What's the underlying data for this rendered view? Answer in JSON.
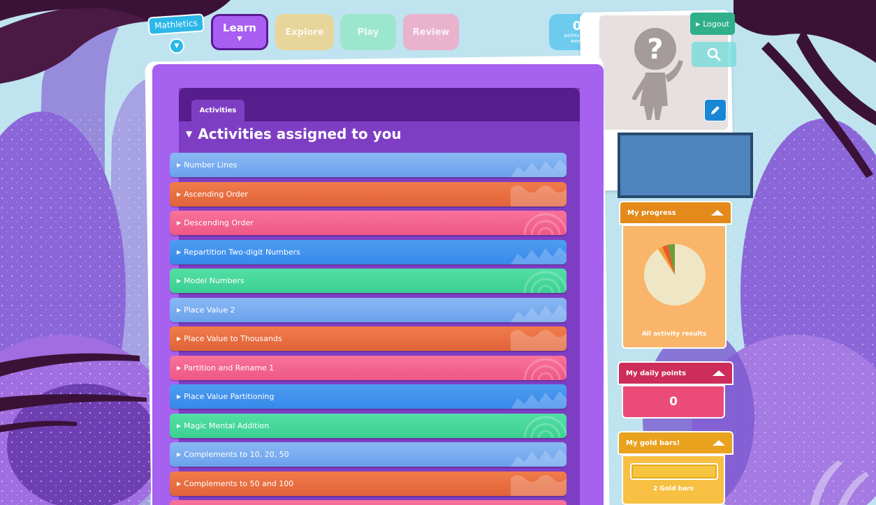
{
  "nav": {
    "brand": "Mathletics",
    "tabs": [
      {
        "label": "Learn"
      },
      {
        "label": "Explore"
      },
      {
        "label": "Play"
      },
      {
        "label": "Review"
      }
    ],
    "points_value": "0",
    "points_label": "points this week"
  },
  "profile": {
    "logout_label": "Logout",
    "avatar_icon": "question-mark-avatar-icon",
    "search_icon": "search-icon",
    "edit_icon": "pencil-icon"
  },
  "activities": {
    "tab_label": "Activities",
    "section_title": "Activities assigned to you",
    "items": [
      {
        "label": "Number Lines",
        "color": "blue1"
      },
      {
        "label": "Ascending Order",
        "color": "orange"
      },
      {
        "label": "Descending Order",
        "color": "pink"
      },
      {
        "label": "Repartition Two-digit Numbers",
        "color": "blue2"
      },
      {
        "label": "Model Numbers",
        "color": "green"
      },
      {
        "label": "Place Value 2",
        "color": "blue1"
      },
      {
        "label": "Place Value to Thousands",
        "color": "orange"
      },
      {
        "label": "Partition and Rename 1",
        "color": "pink"
      },
      {
        "label": "Place Value Partitioning",
        "color": "blue2"
      },
      {
        "label": "Magic Mental Addition",
        "color": "green"
      },
      {
        "label": "Complements to 10, 20, 50",
        "color": "blue1"
      },
      {
        "label": "Complements to 50 and 100",
        "color": "orange"
      },
      {
        "label": "",
        "color": "pink"
      }
    ]
  },
  "widgets": {
    "progress": {
      "title": "My progress",
      "caption": "All activity results"
    },
    "daily_points": {
      "title": "My daily points",
      "value": "0"
    },
    "gold_bars": {
      "title": "My gold bars!",
      "caption": "2 Gold bars"
    }
  },
  "colors": {
    "panel": "#a761ef",
    "panel_dark": "#561e8c",
    "blue1": "#7aadf0",
    "orange": "#e8703f",
    "pink": "#f36590",
    "blue2": "#4292ee",
    "green": "#47d79c",
    "progress": "#f9b56a",
    "daily": "#ea4b79",
    "gold": "#f7c043"
  }
}
